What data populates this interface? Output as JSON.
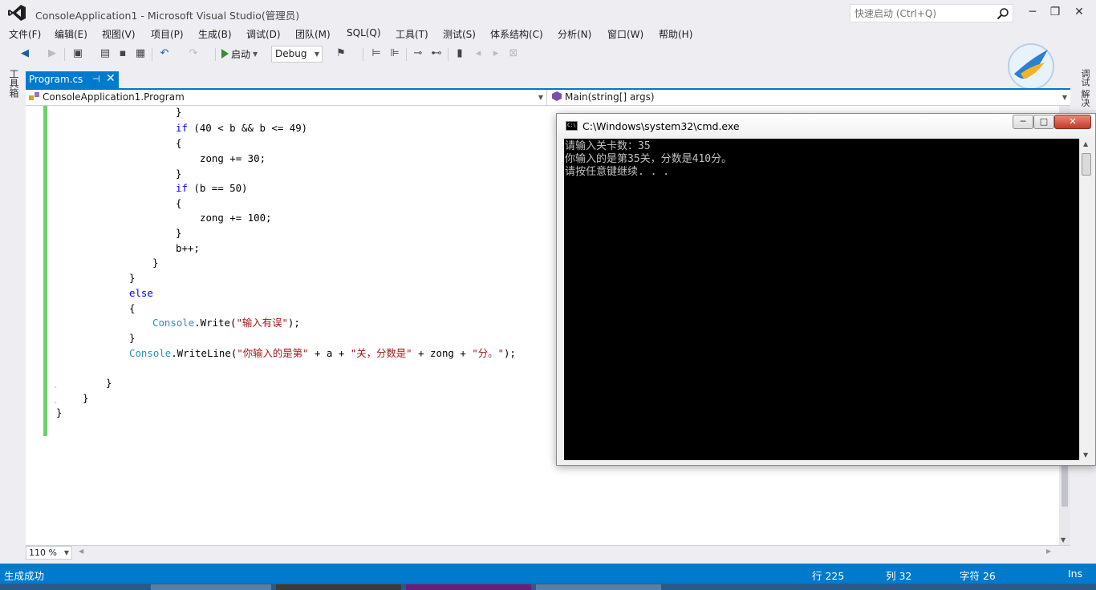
{
  "window": {
    "title": "ConsoleApplication1 - Microsoft Visual Studio(管理员)",
    "quick_launch_placeholder": "快速启动 (Ctrl+Q)",
    "minimize": "─",
    "maximize": "❐",
    "close": "✕"
  },
  "menu": [
    {
      "label": "文件(F)"
    },
    {
      "label": "编辑(E)"
    },
    {
      "label": "视图(V)"
    },
    {
      "label": "项目(P)"
    },
    {
      "label": "生成(B)"
    },
    {
      "label": "调试(D)"
    },
    {
      "label": "团队(M)"
    },
    {
      "label": "SQL(Q)"
    },
    {
      "label": "工具(T)"
    },
    {
      "label": "测试(S)"
    },
    {
      "label": "体系结构(C)"
    },
    {
      "label": "分析(N)"
    },
    {
      "label": "窗口(W)"
    },
    {
      "label": "帮助(H)"
    }
  ],
  "toolbar": {
    "start_label": "启动",
    "config_value": "Debug"
  },
  "left_strip": {
    "label": "工具箱"
  },
  "right_strip": {
    "label": "调试 解决"
  },
  "editor": {
    "tab_label": "Program.cs",
    "tab_pin": "⊣",
    "tab_close": "✕",
    "nav_class": "ConsoleApplication1.Program",
    "nav_member": "Main(string[] args)",
    "zoom": "110 %"
  },
  "status": {
    "message": "生成成功",
    "line": "行 225",
    "col": "列 32",
    "char": "字符 26",
    "mode": "Ins"
  },
  "cmd": {
    "title": "C:\\Windows\\system32\\cmd.exe",
    "icon_text": "C:\\",
    "minimize": "─",
    "maximize": "□",
    "close": "✕",
    "lines": [
      "请输入关卡数：35",
      "你输入的是第35关，分数是410分。",
      "请按任意键继续. . ."
    ]
  }
}
